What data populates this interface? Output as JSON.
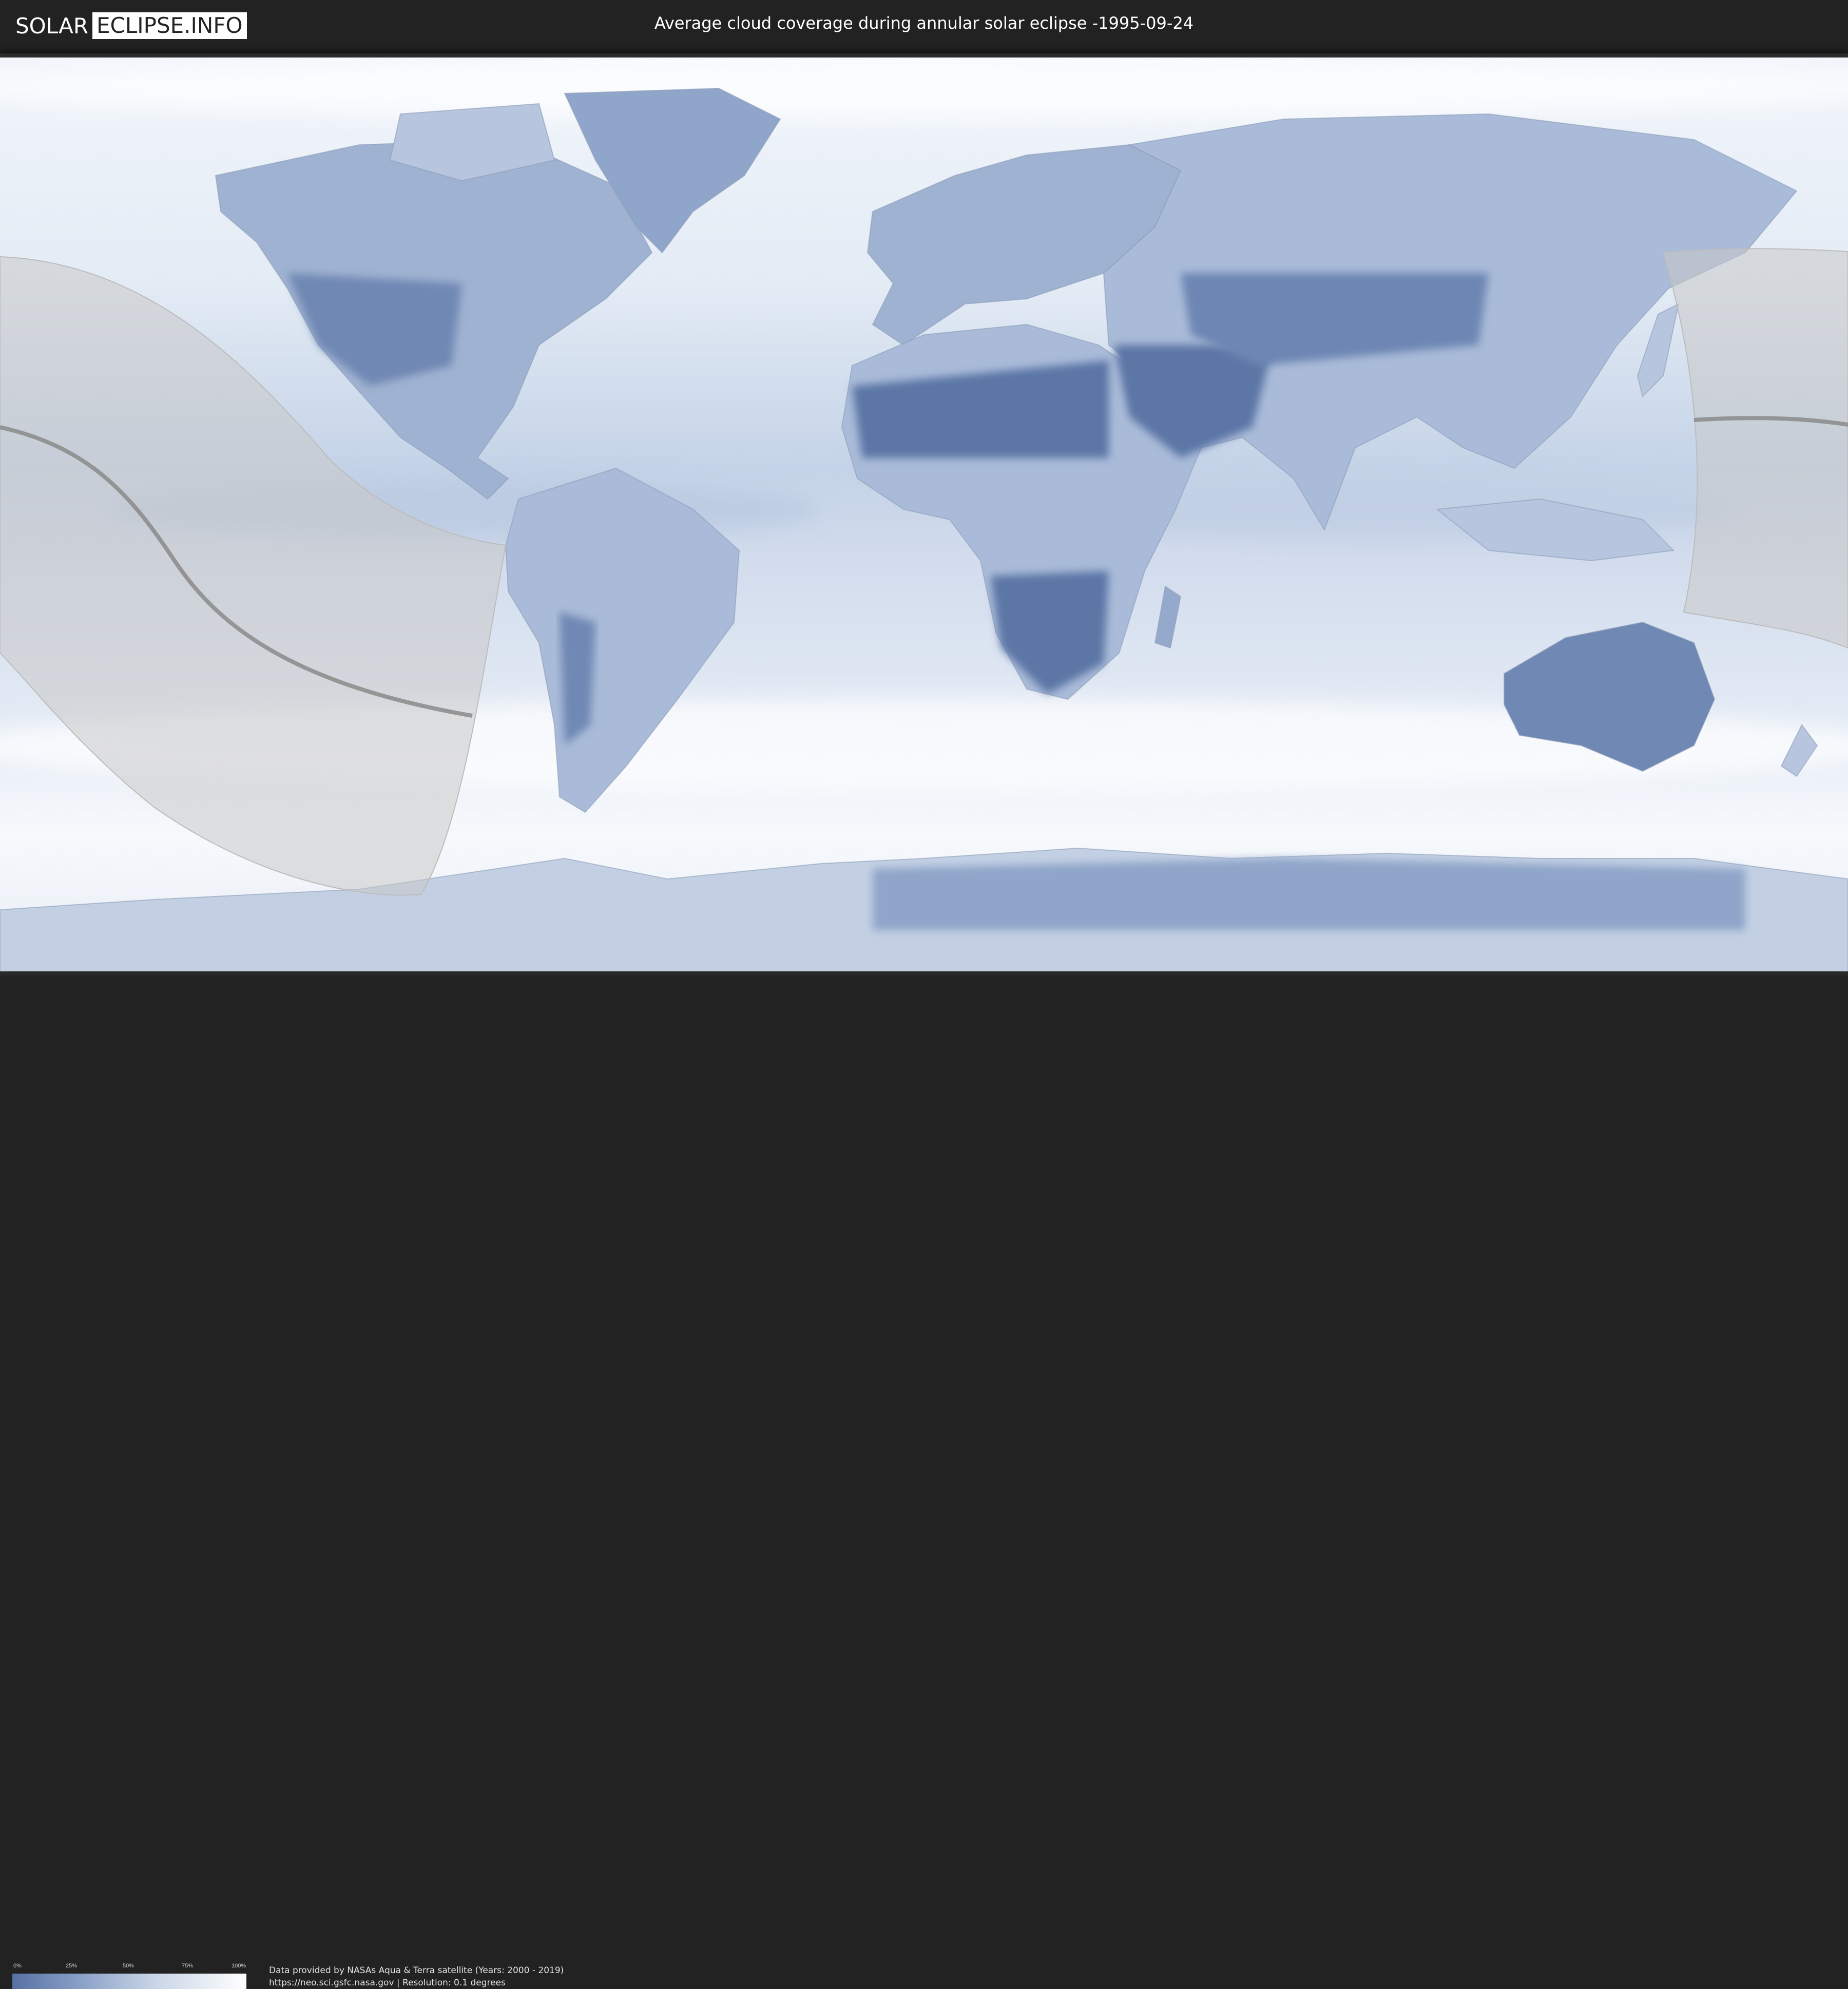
{
  "header": {
    "logo_left": "SOLAR",
    "logo_right": "ECLIPSE.INFO",
    "title": "Average cloud coverage during annular solar eclipse -1995-09-24"
  },
  "legend": {
    "labels": [
      "0%",
      "25%",
      "50%",
      "75%",
      "100%"
    ],
    "colors": {
      "clear": "#5671a4",
      "mid": "#c8d4e6",
      "cloudy": "#ffffff"
    }
  },
  "footer": {
    "credit_line1": "Data provided by NASAs Aqua & Terra satellite (Years: 2000 - 2019)",
    "credit_line2": "https://neo.sci.gsfc.nasa.gov | Resolution: 0.1 degrees"
  },
  "map": {
    "projection": "equirectangular",
    "ocean_color": "#dfe8f3",
    "land_clear_color": "#6d86b3",
    "eclipse_shadow_color": "#c8c8c8",
    "central_line_color": "#8a8a8a"
  }
}
